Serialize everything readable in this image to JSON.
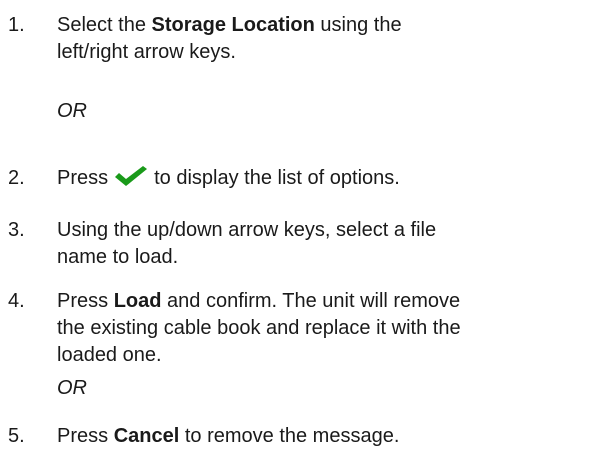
{
  "steps": [
    {
      "number": "1.",
      "line1_before": "Select the ",
      "line1_bold": "Storage Location",
      "line1_after": " using the",
      "line2": "left/right arrow keys."
    },
    {
      "number": "2.",
      "before": "Press",
      "after": "to display the list of options.",
      "icon": "green-check-icon",
      "icon_color": "#1a9a1a"
    },
    {
      "number": "3.",
      "line1": "Using the up/down arrow keys, select a file",
      "line2": "name to load."
    },
    {
      "number": "4.",
      "line1_before": "Press ",
      "line1_bold": "Load",
      "line1_after": " and confirm. The unit will remove",
      "line2": "the existing cable book and replace it with the",
      "line3": "loaded one."
    },
    {
      "number": "5.",
      "before": "Press ",
      "bold": "Cancel",
      "after": " to remove the message."
    }
  ],
  "or_labels": [
    "OR",
    "OR"
  ]
}
